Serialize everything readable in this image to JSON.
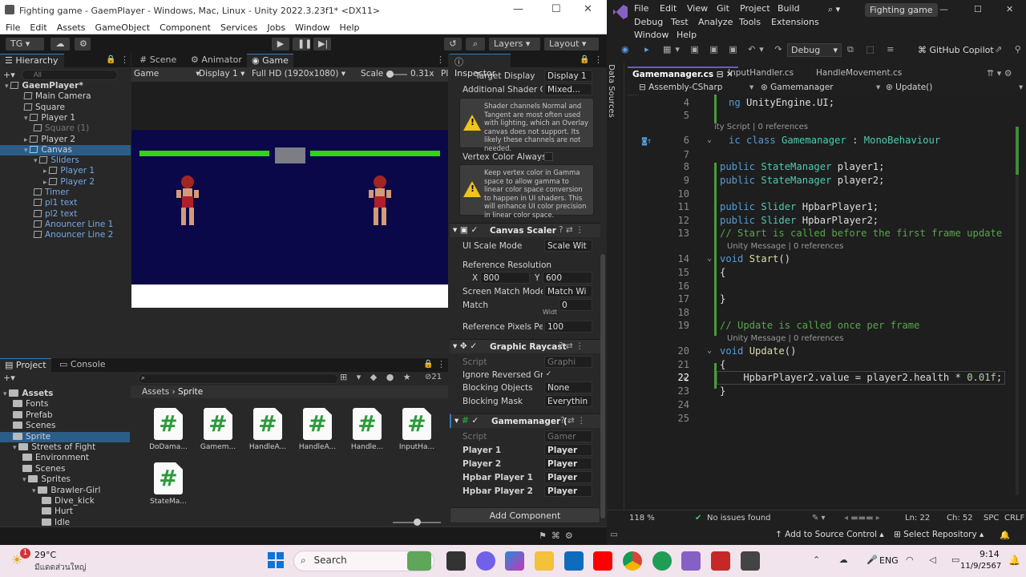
{
  "unity": {
    "title": "Fighting game - GaemPlayer - Windows, Mac, Linux - Unity 2022.3.23f1* <DX11>",
    "menu": [
      "File",
      "Edit",
      "Assets",
      "GameObject",
      "Component",
      "Services",
      "Jobs",
      "Window",
      "Help"
    ],
    "toolbar": {
      "account": "TG",
      "layers": "Layers",
      "layout": "Layout"
    },
    "hierarchy": {
      "tab": "Hierarchy",
      "search_placeholder": "All",
      "items": [
        {
          "label": "GaemPlayer*",
          "indent": 0,
          "bold": true
        },
        {
          "label": "Main Camera",
          "indent": 2
        },
        {
          "label": "Square",
          "indent": 2
        },
        {
          "label": "Player 1",
          "indent": 2
        },
        {
          "label": "Square (1)",
          "indent": 3,
          "dim": true
        },
        {
          "label": "Player 2",
          "indent": 2
        },
        {
          "label": "Canvas",
          "indent": 2,
          "selected": true
        },
        {
          "label": "Sliders",
          "indent": 3,
          "blue": true
        },
        {
          "label": "Player 1",
          "indent": 4,
          "blue": true
        },
        {
          "label": "Player 2",
          "indent": 4,
          "blue": true
        },
        {
          "label": "Timer",
          "indent": 3,
          "blue": true
        },
        {
          "label": "pl1 text",
          "indent": 3,
          "blue": true
        },
        {
          "label": "pl2 text",
          "indent": 3,
          "blue": true
        },
        {
          "label": "Anouncer Line 1",
          "indent": 3,
          "blue": true
        },
        {
          "label": "Anouncer Line 2",
          "indent": 3,
          "blue": true
        }
      ]
    },
    "game": {
      "tabs": [
        "Scene",
        "Animator",
        "Game"
      ],
      "mode": "Game",
      "display": "Display 1",
      "resolution": "Full HD (1920x1080)",
      "scale_label": "Scale",
      "scale_value": "0.31x",
      "play_label": "Pl"
    },
    "inspector": {
      "tab": "Inspector",
      "target_display": {
        "label": "Target Display",
        "value": "Display 1"
      },
      "additional_shader": {
        "label": "Additional Shader Ch",
        "value": "Mixed..."
      },
      "warn1": "Shader channels Normal and Tangent are most often used with lighting, which an Overlay canvas does not support. Its likely these channels are not needed.",
      "vertex_color": {
        "label": "Vertex Color Always"
      },
      "warn2": "Keep vertex color in Gamma space to allow gamma to linear color space conversion to happen in UI shaders. This will enhance UI color precision in linear color space.",
      "canvas_scaler": {
        "title": "Canvas Scaler",
        "ui_scale_mode_label": "UI Scale Mode",
        "ui_scale_mode": "Scale Wit",
        "ref_res_label": "Reference Resolution",
        "x_label": "X",
        "x": "800",
        "y_label": "Y",
        "y": "600",
        "screen_match_label": "Screen Match Mode",
        "screen_match": "Match Wi",
        "match_label": "Match",
        "match_value": "0",
        "match_hint": "Widt",
        "ref_pixels_label": "Reference Pixels Per",
        "ref_pixels": "100"
      },
      "graphic_raycaster": {
        "title": "Graphic Raycast",
        "script_label": "Script",
        "script": "Graphi",
        "ignore_label": "Ignore Reversed Gra",
        "blocking_objects_label": "Blocking Objects",
        "blocking_objects": "None",
        "blocking_mask_label": "Blocking Mask",
        "blocking_mask": "Everythin"
      },
      "gamemanager": {
        "title": "Gamemanager (",
        "script_label": "Script",
        "script": "Gamer",
        "fields": [
          {
            "label": "Player 1",
            "value": "Player"
          },
          {
            "label": "Player 2",
            "value": "Player"
          },
          {
            "label": "Hpbar Player 1",
            "value": "Player"
          },
          {
            "label": "Hpbar Player 2",
            "value": "Player"
          }
        ]
      },
      "add_component": "Add Component"
    },
    "project": {
      "tabs": [
        "Project",
        "Console"
      ],
      "count": "21",
      "tree": [
        {
          "label": "Assets",
          "indent": 0,
          "bold": true
        },
        {
          "label": "Fonts",
          "indent": 1
        },
        {
          "label": "Prefab",
          "indent": 1
        },
        {
          "label": "Scenes",
          "indent": 1
        },
        {
          "label": "Sprite",
          "indent": 1,
          "selected": true
        },
        {
          "label": "Streets of Fight",
          "indent": 1
        },
        {
          "label": "Environment",
          "indent": 2
        },
        {
          "label": "Scenes",
          "indent": 2
        },
        {
          "label": "Sprites",
          "indent": 2
        },
        {
          "label": "Brawler-Girl",
          "indent": 3
        },
        {
          "label": "Dive_kick",
          "indent": 4
        },
        {
          "label": "Hurt",
          "indent": 4
        },
        {
          "label": "Idle",
          "indent": 4
        }
      ],
      "breadcrumb": [
        "Assets",
        "Sprite"
      ],
      "assets": [
        "DoDama...",
        "Gamem...",
        "HandleA...",
        "HandleA...",
        "Handle...",
        "InputHa...",
        "StateMa..."
      ]
    }
  },
  "vs": {
    "menu_row1": [
      "File",
      "Edit",
      "View",
      "Git",
      "Project",
      "Build"
    ],
    "menu_row2": [
      "Debug",
      "Test",
      "Analyze",
      "Tools",
      "Extensions"
    ],
    "menu_row3": [
      "Window",
      "Help"
    ],
    "solution_title": "Fighting game",
    "config": "Debug",
    "copilot": "GitHub Copilot",
    "side_label": "Data Sources",
    "tabs": [
      "Gamemanager.cs",
      "InputHandler.cs",
      "HandleMovement.cs"
    ],
    "nav": {
      "project": "Assembly-CSharp",
      "class": "Gamemanager",
      "member": "Update()"
    },
    "lines": [
      {
        "n": "4",
        "html": "<span class='kw'>ng</span> UnityEngine.UI;",
        "indent": 0
      },
      {
        "n": "5",
        "html": "",
        "indent": 0
      },
      {
        "n": "6",
        "html": "<span class='kw'>ic class</span> <span class='ty'>Gamemanager</span> : <span class='ty'>MonoBehaviour</span>",
        "indent": 0
      },
      {
        "n": "7",
        "html": "",
        "indent": 0
      },
      {
        "n": "8",
        "html": "<span class='kw'>public</span> <span class='ty'>StateManager</span> player1;",
        "indent": 1
      },
      {
        "n": "9",
        "html": "<span class='kw'>public</span> <span class='ty'>StateManager</span> player2;",
        "indent": 1
      },
      {
        "n": "10",
        "html": "",
        "indent": 1
      },
      {
        "n": "11",
        "html": "<span class='kw'>public</span> <span class='ty'>Slider</span> HpbarPlayer1;",
        "indent": 1
      },
      {
        "n": "12",
        "html": "<span class='kw'>public</span> <span class='ty'>Slider</span> HpbarPlayer2;",
        "indent": 1
      },
      {
        "n": "13",
        "html": "<span class='cm'>// Start is called before the first frame update</span>",
        "indent": 1
      },
      {
        "n": "14",
        "html": "<span class='kw'>void</span> <span class='fn'>Start</span>()",
        "indent": 1
      },
      {
        "n": "15",
        "html": "{",
        "indent": 1
      },
      {
        "n": "16",
        "html": "",
        "indent": 1
      },
      {
        "n": "17",
        "html": "}",
        "indent": 1
      },
      {
        "n": "18",
        "html": "",
        "indent": 1
      },
      {
        "n": "19",
        "html": "<span class='cm'>// Update is called once per frame</span>",
        "indent": 1
      },
      {
        "n": "20",
        "html": "<span class='kw'>void</span> <span class='fn'>Update</span>()",
        "indent": 1
      },
      {
        "n": "21",
        "html": "{",
        "indent": 1
      },
      {
        "n": "22",
        "html": "    HpbarPlayer2.value = player2.health * <span class='nm'>0.01f</span>;",
        "indent": 1
      },
      {
        "n": "23",
        "html": "}",
        "indent": 1
      },
      {
        "n": "24",
        "html": "",
        "indent": 1
      },
      {
        "n": "25",
        "html": "",
        "indent": 1
      }
    ],
    "lens": {
      "class": "ity Script | 0 references",
      "start": "Unity Message | 0 references",
      "update": "Unity Message | 0 references"
    },
    "status": {
      "zoom": "118 %",
      "issues": "No issues found",
      "ln": "Ln: 22",
      "ch": "Ch: 52",
      "spc": "SPC",
      "crlf": "CRLF"
    },
    "bottom": {
      "source_control": "Add to Source Control",
      "repo": "Select Repository"
    }
  },
  "taskbar": {
    "weather_temp": "29°C",
    "weather_desc": "มีแดดส่วนใหญ่",
    "badge": "1",
    "search": "Search",
    "lang": "ENG",
    "time": "9:14",
    "date": "11/9/2567"
  },
  "colors": {
    "accent": "#3a79bb",
    "game_bg": "#0a0849",
    "hp_green": "#33d317",
    "vs_purple": "#6a5acd"
  }
}
